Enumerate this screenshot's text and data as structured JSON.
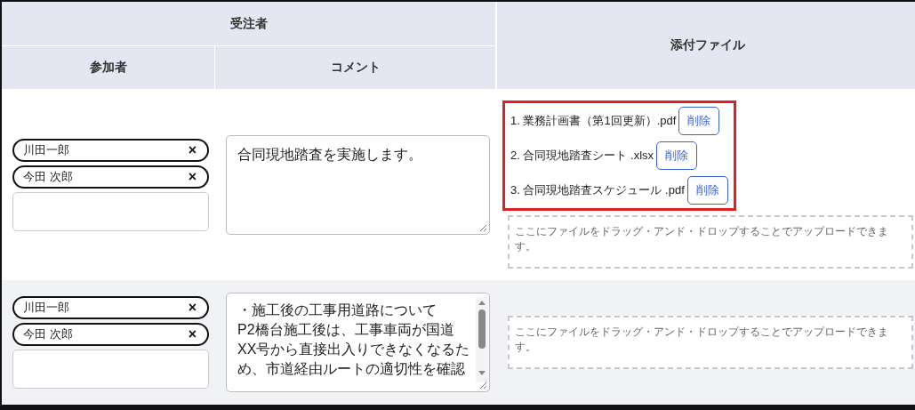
{
  "header": {
    "group_label": "受注者",
    "columns": [
      "参加者",
      "コメント"
    ],
    "attachments_label": "添付ファイル"
  },
  "rows": [
    {
      "participants": [
        {
          "name": "川田一郎",
          "remove": "×"
        },
        {
          "name": "今田 次郎",
          "remove": "×"
        }
      ],
      "comment": "合同現地踏査を実施します。",
      "comment_scrollbar": false,
      "attachments_highlighted": true,
      "files": [
        {
          "label": "1. 業務計画書（第1回更新）.pdf",
          "delete": "削除"
        },
        {
          "label": "2. 合同現地踏査シート .xlsx",
          "delete": "削除"
        },
        {
          "label": "3. 合同現地踏査スケジュール .pdf",
          "delete": "削除"
        }
      ],
      "dropzone": "ここにファイルをドラッグ・アンド・ドロップすることでアップロードできます。"
    },
    {
      "participants": [
        {
          "name": "川田一郎",
          "remove": "×"
        },
        {
          "name": "今田 次郎",
          "remove": "×"
        }
      ],
      "comment": "・施工後の工事用道路について\nP2橋台施工後は、工事車両が国道XX号から直接出入りできなくなるため、市道経由ルートの適切性を確認",
      "comment_scrollbar": true,
      "attachments_highlighted": false,
      "files": [],
      "dropzone": "ここにファイルをドラッグ・アンド・ドロップすることでアップロードできます。"
    }
  ]
}
